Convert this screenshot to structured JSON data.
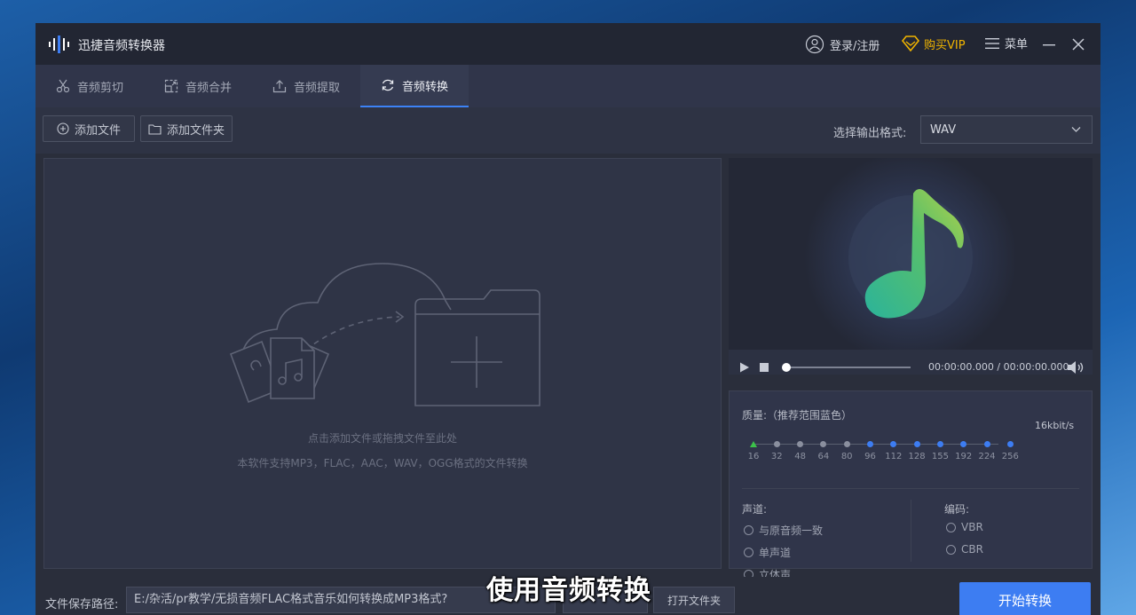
{
  "app": {
    "title": "迅捷音频转换器"
  },
  "titlebar": {
    "login": "登录/注册",
    "vip": "购买VIP",
    "menu": "菜单"
  },
  "tabs": [
    {
      "label": "音频剪切",
      "icon": "scissors-icon"
    },
    {
      "label": "音频合并",
      "icon": "merge-icon"
    },
    {
      "label": "音频提取",
      "icon": "extract-icon"
    },
    {
      "label": "音频转换",
      "icon": "convert-icon",
      "active": true
    }
  ],
  "toolbar": {
    "add_file": "添加文件",
    "add_folder": "添加文件夹",
    "format_label": "选择输出格式:",
    "format_value": "WAV"
  },
  "dropzone": {
    "hint1": "点击添加文件或拖拽文件至此处",
    "hint2": "本软件支持MP3，FLAC，AAC，WAV，OGG格式的文件转换"
  },
  "player": {
    "time": "00:00:00.000 / 00:00:00.000",
    "progress": 0
  },
  "quality": {
    "label": "质量:（推荐范围蓝色）",
    "values": [
      "16",
      "32",
      "48",
      "64",
      "80",
      "96",
      "112",
      "128",
      "155",
      "192",
      "224",
      "256"
    ],
    "selected_index": 0,
    "current": "16kbit/s"
  },
  "channel": {
    "label": "声道:",
    "options": [
      "与原音频一致",
      "单声道",
      "立体声"
    ]
  },
  "encoding": {
    "label": "编码:",
    "options": [
      "VBR",
      "CBR"
    ]
  },
  "bottom": {
    "path_label": "文件保存路径:",
    "path_value": "E:/杂活/pr教学/无损音频FLAC格式音乐如何转换成MP3格式?",
    "open_folder": "打开文件夹",
    "start": "开始转换"
  },
  "overlay_subtitle": "使用音频转换",
  "colors": {
    "accent": "#3d7df2",
    "vip": "#f0b400",
    "grey_dot": "#8a8f9e",
    "green_dot": "#3cc24a"
  }
}
